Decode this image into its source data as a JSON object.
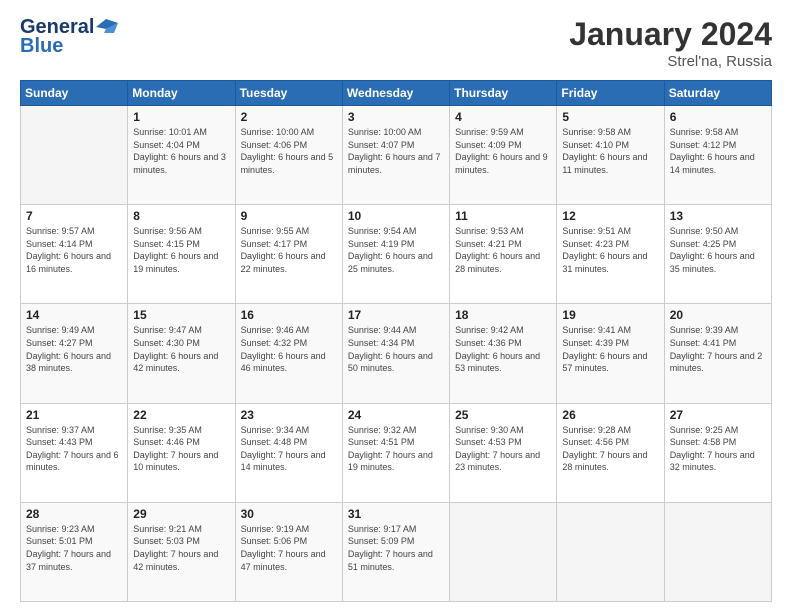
{
  "logo": {
    "line1": "General",
    "line2": "Blue"
  },
  "title": "January 2024",
  "subtitle": "Strel'na, Russia",
  "header_days": [
    "Sunday",
    "Monday",
    "Tuesday",
    "Wednesday",
    "Thursday",
    "Friday",
    "Saturday"
  ],
  "weeks": [
    [
      {
        "day": "",
        "sunrise": "",
        "sunset": "",
        "daylight": ""
      },
      {
        "day": "1",
        "sunrise": "Sunrise: 10:01 AM",
        "sunset": "Sunset: 4:04 PM",
        "daylight": "Daylight: 6 hours and 3 minutes."
      },
      {
        "day": "2",
        "sunrise": "Sunrise: 10:00 AM",
        "sunset": "Sunset: 4:06 PM",
        "daylight": "Daylight: 6 hours and 5 minutes."
      },
      {
        "day": "3",
        "sunrise": "Sunrise: 10:00 AM",
        "sunset": "Sunset: 4:07 PM",
        "daylight": "Daylight: 6 hours and 7 minutes."
      },
      {
        "day": "4",
        "sunrise": "Sunrise: 9:59 AM",
        "sunset": "Sunset: 4:09 PM",
        "daylight": "Daylight: 6 hours and 9 minutes."
      },
      {
        "day": "5",
        "sunrise": "Sunrise: 9:58 AM",
        "sunset": "Sunset: 4:10 PM",
        "daylight": "Daylight: 6 hours and 11 minutes."
      },
      {
        "day": "6",
        "sunrise": "Sunrise: 9:58 AM",
        "sunset": "Sunset: 4:12 PM",
        "daylight": "Daylight: 6 hours and 14 minutes."
      }
    ],
    [
      {
        "day": "7",
        "sunrise": "Sunrise: 9:57 AM",
        "sunset": "Sunset: 4:14 PM",
        "daylight": "Daylight: 6 hours and 16 minutes."
      },
      {
        "day": "8",
        "sunrise": "Sunrise: 9:56 AM",
        "sunset": "Sunset: 4:15 PM",
        "daylight": "Daylight: 6 hours and 19 minutes."
      },
      {
        "day": "9",
        "sunrise": "Sunrise: 9:55 AM",
        "sunset": "Sunset: 4:17 PM",
        "daylight": "Daylight: 6 hours and 22 minutes."
      },
      {
        "day": "10",
        "sunrise": "Sunrise: 9:54 AM",
        "sunset": "Sunset: 4:19 PM",
        "daylight": "Daylight: 6 hours and 25 minutes."
      },
      {
        "day": "11",
        "sunrise": "Sunrise: 9:53 AM",
        "sunset": "Sunset: 4:21 PM",
        "daylight": "Daylight: 6 hours and 28 minutes."
      },
      {
        "day": "12",
        "sunrise": "Sunrise: 9:51 AM",
        "sunset": "Sunset: 4:23 PM",
        "daylight": "Daylight: 6 hours and 31 minutes."
      },
      {
        "day": "13",
        "sunrise": "Sunrise: 9:50 AM",
        "sunset": "Sunset: 4:25 PM",
        "daylight": "Daylight: 6 hours and 35 minutes."
      }
    ],
    [
      {
        "day": "14",
        "sunrise": "Sunrise: 9:49 AM",
        "sunset": "Sunset: 4:27 PM",
        "daylight": "Daylight: 6 hours and 38 minutes."
      },
      {
        "day": "15",
        "sunrise": "Sunrise: 9:47 AM",
        "sunset": "Sunset: 4:30 PM",
        "daylight": "Daylight: 6 hours and 42 minutes."
      },
      {
        "day": "16",
        "sunrise": "Sunrise: 9:46 AM",
        "sunset": "Sunset: 4:32 PM",
        "daylight": "Daylight: 6 hours and 46 minutes."
      },
      {
        "day": "17",
        "sunrise": "Sunrise: 9:44 AM",
        "sunset": "Sunset: 4:34 PM",
        "daylight": "Daylight: 6 hours and 50 minutes."
      },
      {
        "day": "18",
        "sunrise": "Sunrise: 9:42 AM",
        "sunset": "Sunset: 4:36 PM",
        "daylight": "Daylight: 6 hours and 53 minutes."
      },
      {
        "day": "19",
        "sunrise": "Sunrise: 9:41 AM",
        "sunset": "Sunset: 4:39 PM",
        "daylight": "Daylight: 6 hours and 57 minutes."
      },
      {
        "day": "20",
        "sunrise": "Sunrise: 9:39 AM",
        "sunset": "Sunset: 4:41 PM",
        "daylight": "Daylight: 7 hours and 2 minutes."
      }
    ],
    [
      {
        "day": "21",
        "sunrise": "Sunrise: 9:37 AM",
        "sunset": "Sunset: 4:43 PM",
        "daylight": "Daylight: 7 hours and 6 minutes."
      },
      {
        "day": "22",
        "sunrise": "Sunrise: 9:35 AM",
        "sunset": "Sunset: 4:46 PM",
        "daylight": "Daylight: 7 hours and 10 minutes."
      },
      {
        "day": "23",
        "sunrise": "Sunrise: 9:34 AM",
        "sunset": "Sunset: 4:48 PM",
        "daylight": "Daylight: 7 hours and 14 minutes."
      },
      {
        "day": "24",
        "sunrise": "Sunrise: 9:32 AM",
        "sunset": "Sunset: 4:51 PM",
        "daylight": "Daylight: 7 hours and 19 minutes."
      },
      {
        "day": "25",
        "sunrise": "Sunrise: 9:30 AM",
        "sunset": "Sunset: 4:53 PM",
        "daylight": "Daylight: 7 hours and 23 minutes."
      },
      {
        "day": "26",
        "sunrise": "Sunrise: 9:28 AM",
        "sunset": "Sunset: 4:56 PM",
        "daylight": "Daylight: 7 hours and 28 minutes."
      },
      {
        "day": "27",
        "sunrise": "Sunrise: 9:25 AM",
        "sunset": "Sunset: 4:58 PM",
        "daylight": "Daylight: 7 hours and 32 minutes."
      }
    ],
    [
      {
        "day": "28",
        "sunrise": "Sunrise: 9:23 AM",
        "sunset": "Sunset: 5:01 PM",
        "daylight": "Daylight: 7 hours and 37 minutes."
      },
      {
        "day": "29",
        "sunrise": "Sunrise: 9:21 AM",
        "sunset": "Sunset: 5:03 PM",
        "daylight": "Daylight: 7 hours and 42 minutes."
      },
      {
        "day": "30",
        "sunrise": "Sunrise: 9:19 AM",
        "sunset": "Sunset: 5:06 PM",
        "daylight": "Daylight: 7 hours and 47 minutes."
      },
      {
        "day": "31",
        "sunrise": "Sunrise: 9:17 AM",
        "sunset": "Sunset: 5:09 PM",
        "daylight": "Daylight: 7 hours and 51 minutes."
      },
      {
        "day": "",
        "sunrise": "",
        "sunset": "",
        "daylight": ""
      },
      {
        "day": "",
        "sunrise": "",
        "sunset": "",
        "daylight": ""
      },
      {
        "day": "",
        "sunrise": "",
        "sunset": "",
        "daylight": ""
      }
    ]
  ]
}
